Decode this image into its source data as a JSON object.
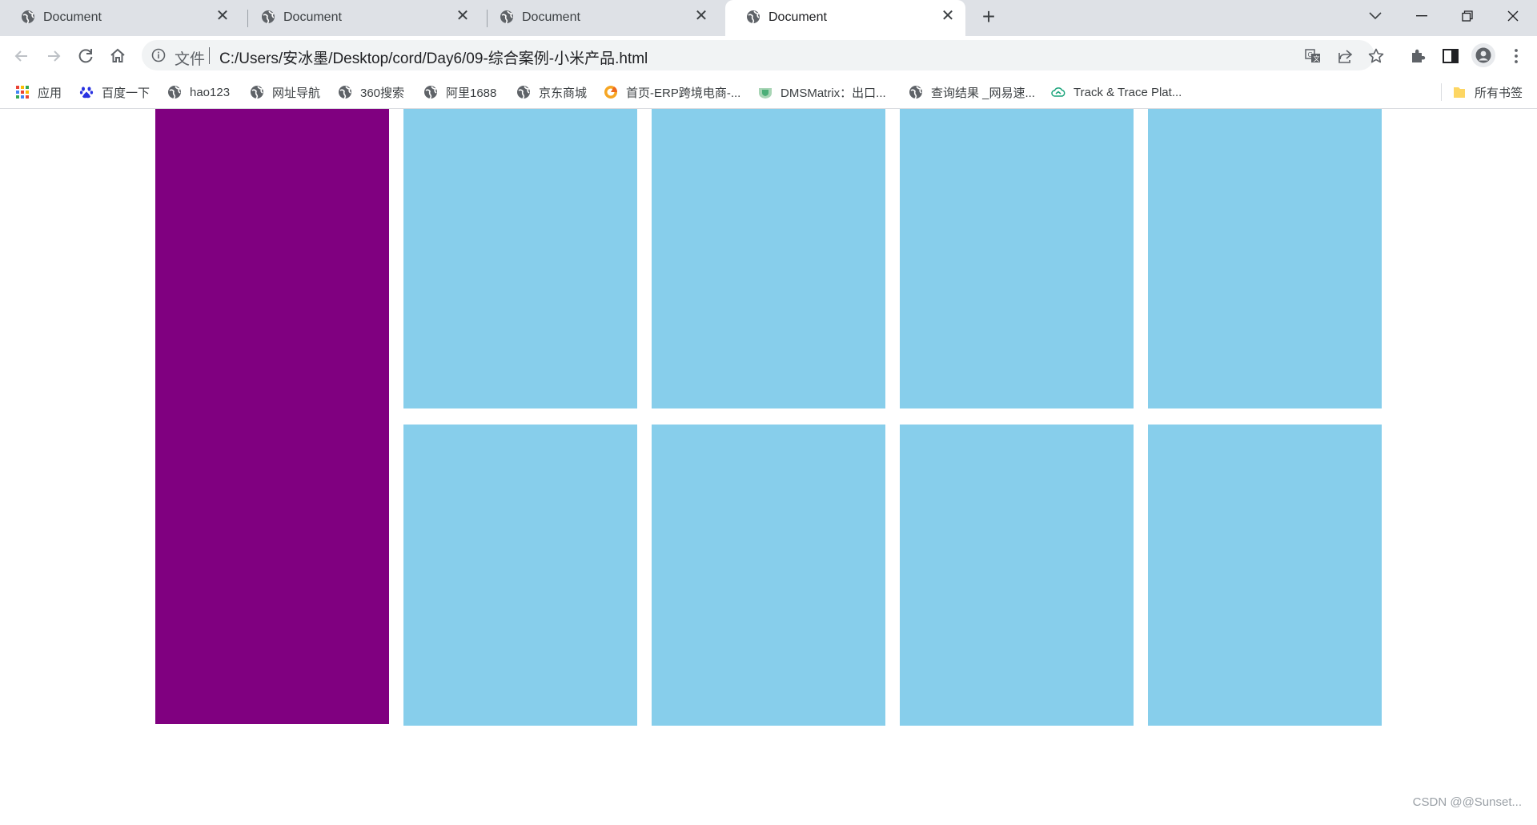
{
  "tabs": [
    {
      "title": "Document",
      "active": false
    },
    {
      "title": "Document",
      "active": false
    },
    {
      "title": "Document",
      "active": false
    },
    {
      "title": "Document",
      "active": true
    }
  ],
  "toolbar": {
    "address_scheme": "文件",
    "address_url": "C:/Users/安冰墨/Desktop/cord/Day6/09-综合案例-小米产品.html"
  },
  "bookmarks": [
    {
      "label": "应用",
      "icon": "apps-grid-icon"
    },
    {
      "label": "百度一下",
      "icon": "baidu-paw-icon"
    },
    {
      "label": "hao123",
      "icon": "globe-icon"
    },
    {
      "label": "网址导航",
      "icon": "globe-icon"
    },
    {
      "label": "360搜索",
      "icon": "globe-icon"
    },
    {
      "label": "阿里1688",
      "icon": "globe-icon"
    },
    {
      "label": "京东商城",
      "icon": "globe-icon"
    },
    {
      "label": "首页-ERP跨境电商-...",
      "icon": "erp-logo-icon"
    },
    {
      "label": "DMSMatrix：出口...",
      "icon": "dms-logo-icon"
    },
    {
      "label": "查询结果 _网易速...",
      "icon": "globe-icon"
    },
    {
      "label": "Track & Trace Plat...",
      "icon": "cloud-icon"
    }
  ],
  "all_bookmarks_label": "所有书签",
  "page": {
    "left_box_color": "#800080",
    "box_color": "#87ceeb",
    "box_count": 8
  },
  "watermark": "CSDN @@Sunset..."
}
